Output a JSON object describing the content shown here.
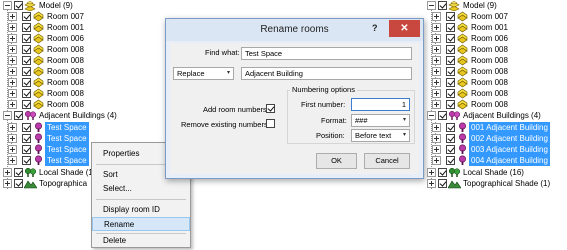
{
  "left_tree": {
    "model": {
      "label": "Model (9)"
    },
    "rooms": [
      {
        "label": "Room 007"
      },
      {
        "label": "Room 001"
      },
      {
        "label": "Room 006"
      },
      {
        "label": "Room 008"
      },
      {
        "label": "Room 008"
      },
      {
        "label": "Room 008"
      },
      {
        "label": "Room 008"
      },
      {
        "label": "Room 008"
      },
      {
        "label": "Room 008"
      }
    ],
    "adjacent": {
      "label": "Adjacent Buildings (4)"
    },
    "adjacent_children": [
      {
        "label": "Test Space"
      },
      {
        "label": "Test Space"
      },
      {
        "label": "Test Space"
      },
      {
        "label": "Test Space"
      }
    ],
    "local_shade": {
      "label": "Local Shade (1"
    },
    "topographical": {
      "label": "Topographica"
    }
  },
  "context_menu": {
    "items": [
      {
        "label": "Properties"
      },
      {
        "label": "Sort"
      },
      {
        "label": "Select..."
      },
      {
        "label": "Display room ID"
      },
      {
        "label": "Rename"
      },
      {
        "label": "Delete"
      }
    ],
    "submenu_arrow": "▸"
  },
  "dialog": {
    "title": "Rename rooms",
    "help": "?",
    "close": "✕",
    "find_label": "Find what:",
    "find_value": "Test Space",
    "mode_value": "Replace",
    "mode_arrow": "▾",
    "replace_value": "Adjacent Building",
    "add_numbers_label": "Add room numbers?",
    "add_numbers_checked": true,
    "remove_numbers_label": "Remove existing numbers?",
    "remove_numbers_checked": false,
    "numbering_group_label": "Numbering options",
    "first_number_label": "First number:",
    "first_number_value": "1",
    "format_label": "Format:",
    "format_value": "###",
    "format_arrow": "▾",
    "position_label": "Position:",
    "position_value": "Before text",
    "position_arrow": "▾",
    "ok_label": "OK",
    "cancel_label": "Cancel"
  },
  "right_tree": {
    "model": {
      "label": "Model (9)"
    },
    "rooms": [
      {
        "label": "Room 007"
      },
      {
        "label": "Room 001"
      },
      {
        "label": "Room 006"
      },
      {
        "label": "Room 008"
      },
      {
        "label": "Room 008"
      },
      {
        "label": "Room 008"
      },
      {
        "label": "Room 008"
      },
      {
        "label": "Room 008"
      },
      {
        "label": "Room 008"
      }
    ],
    "adjacent": {
      "label": "Adjacent Buildings (4)"
    },
    "adjacent_children": [
      {
        "label": "001 Adjacent Building"
      },
      {
        "label": "002 Adjacent Building"
      },
      {
        "label": "003 Adjacent Building"
      },
      {
        "label": "004 Adjacent Building"
      }
    ],
    "local_shade": {
      "label": "Local Shade (16)"
    },
    "topographical": {
      "label": "Topographical Shade (1)"
    }
  },
  "colors": {
    "selection": "#3399ff",
    "menu_highlight": "#d6e8f8",
    "dialog_frame": "#7a9cc6",
    "close_button": "#c8473f",
    "room_icon_yellow": "#e8c820",
    "adjacent_icon_purple": "#a02a9a",
    "shade_icon_green": "#2e8b2e"
  }
}
